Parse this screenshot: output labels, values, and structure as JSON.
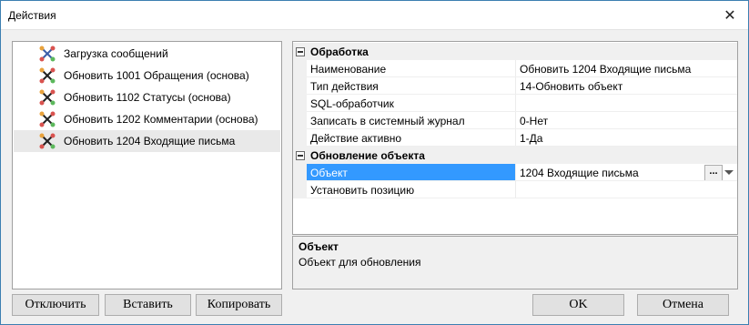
{
  "window": {
    "title": "Действия",
    "close_glyph": "✕"
  },
  "tree": {
    "items": [
      {
        "label": "Загрузка сообщений",
        "icon": "scissors-diagram-icon",
        "selected": false
      },
      {
        "label": "Обновить 1001 Обращения (основа)",
        "icon": "scissors-diagram-icon",
        "selected": false
      },
      {
        "label": "Обновить 1102 Статусы (основа)",
        "icon": "scissors-diagram-icon",
        "selected": false
      },
      {
        "label": "Обновить 1202 Комментарии (основа)",
        "icon": "scissors-diagram-icon",
        "selected": false
      },
      {
        "label": "Обновить 1204 Входящие письма",
        "icon": "scissors-diagram-icon",
        "selected": true
      }
    ]
  },
  "properties": {
    "cat1": "Обработка",
    "rows1": [
      {
        "name": "Наименование",
        "value": "Обновить 1204 Входящие письма"
      },
      {
        "name": "Тип действия",
        "value": "14-Обновить объект"
      },
      {
        "name": "SQL-обработчик",
        "value": ""
      },
      {
        "name": "Записать в системный журнал",
        "value": "0-Нет"
      },
      {
        "name": "Действие активно",
        "value": "1-Да"
      }
    ],
    "cat2": "Обновление объекта",
    "rows2": [
      {
        "name": "Объект",
        "value": "1204 Входящие письма",
        "selected": true,
        "ellipsis": "..."
      },
      {
        "name": "Установить позицию",
        "value": ""
      }
    ]
  },
  "description": {
    "title": "Объект",
    "text": "Объект для обновления"
  },
  "buttons": {
    "disable": "Отключить",
    "paste": "Вставить",
    "copy": "Копировать",
    "ok": "OK",
    "cancel": "Отмена"
  },
  "colors": {
    "selection": "#3399ff",
    "border": "#a0a0a0",
    "window_border": "#3c7fb1"
  }
}
